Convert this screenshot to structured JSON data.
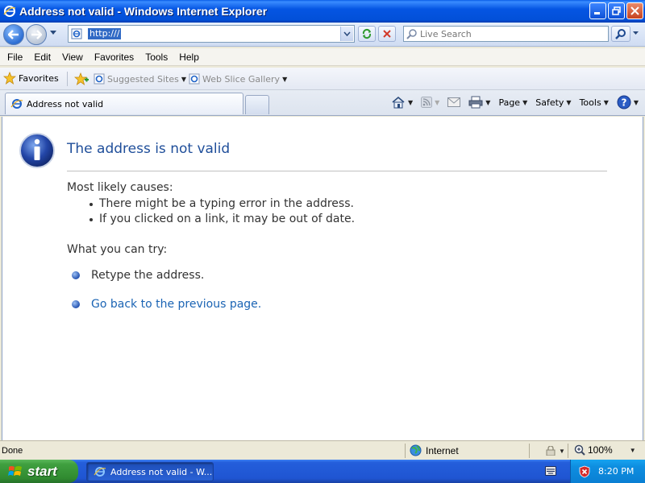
{
  "window": {
    "title": "Address not valid - Windows Internet Explorer"
  },
  "nav": {
    "url": "http:///",
    "search_placeholder": "Live Search"
  },
  "menu": [
    "File",
    "Edit",
    "View",
    "Favorites",
    "Tools",
    "Help"
  ],
  "favorites_bar": {
    "favorites_label": "Favorites",
    "links": [
      "Suggested Sites",
      "Web Slice Gallery"
    ]
  },
  "tabs": {
    "active_tab": "Address not valid"
  },
  "command_bar": {
    "page": "Page",
    "safety": "Safety",
    "tools": "Tools"
  },
  "error_page": {
    "heading": "The address is not valid",
    "causes_heading": "Most likely causes:",
    "causes": [
      "There might be a typing error in the address.",
      "If you clicked on a link, it may be out of date."
    ],
    "try_heading": "What you can try:",
    "actions": [
      "Retype the address.",
      "Go back to the previous page."
    ]
  },
  "status_bar": {
    "status": "Done",
    "zone": "Internet",
    "zoom": "100%"
  },
  "taskbar": {
    "start_label": "start",
    "task_label": "Address not valid - W...",
    "clock": "8:20 PM"
  },
  "colors": {
    "title_bar": "#0555e3",
    "heading_text": "#1f4e9a",
    "link_text": "#1b64b4",
    "start_button": "#3f9f3f",
    "taskbar": "#245edb"
  }
}
